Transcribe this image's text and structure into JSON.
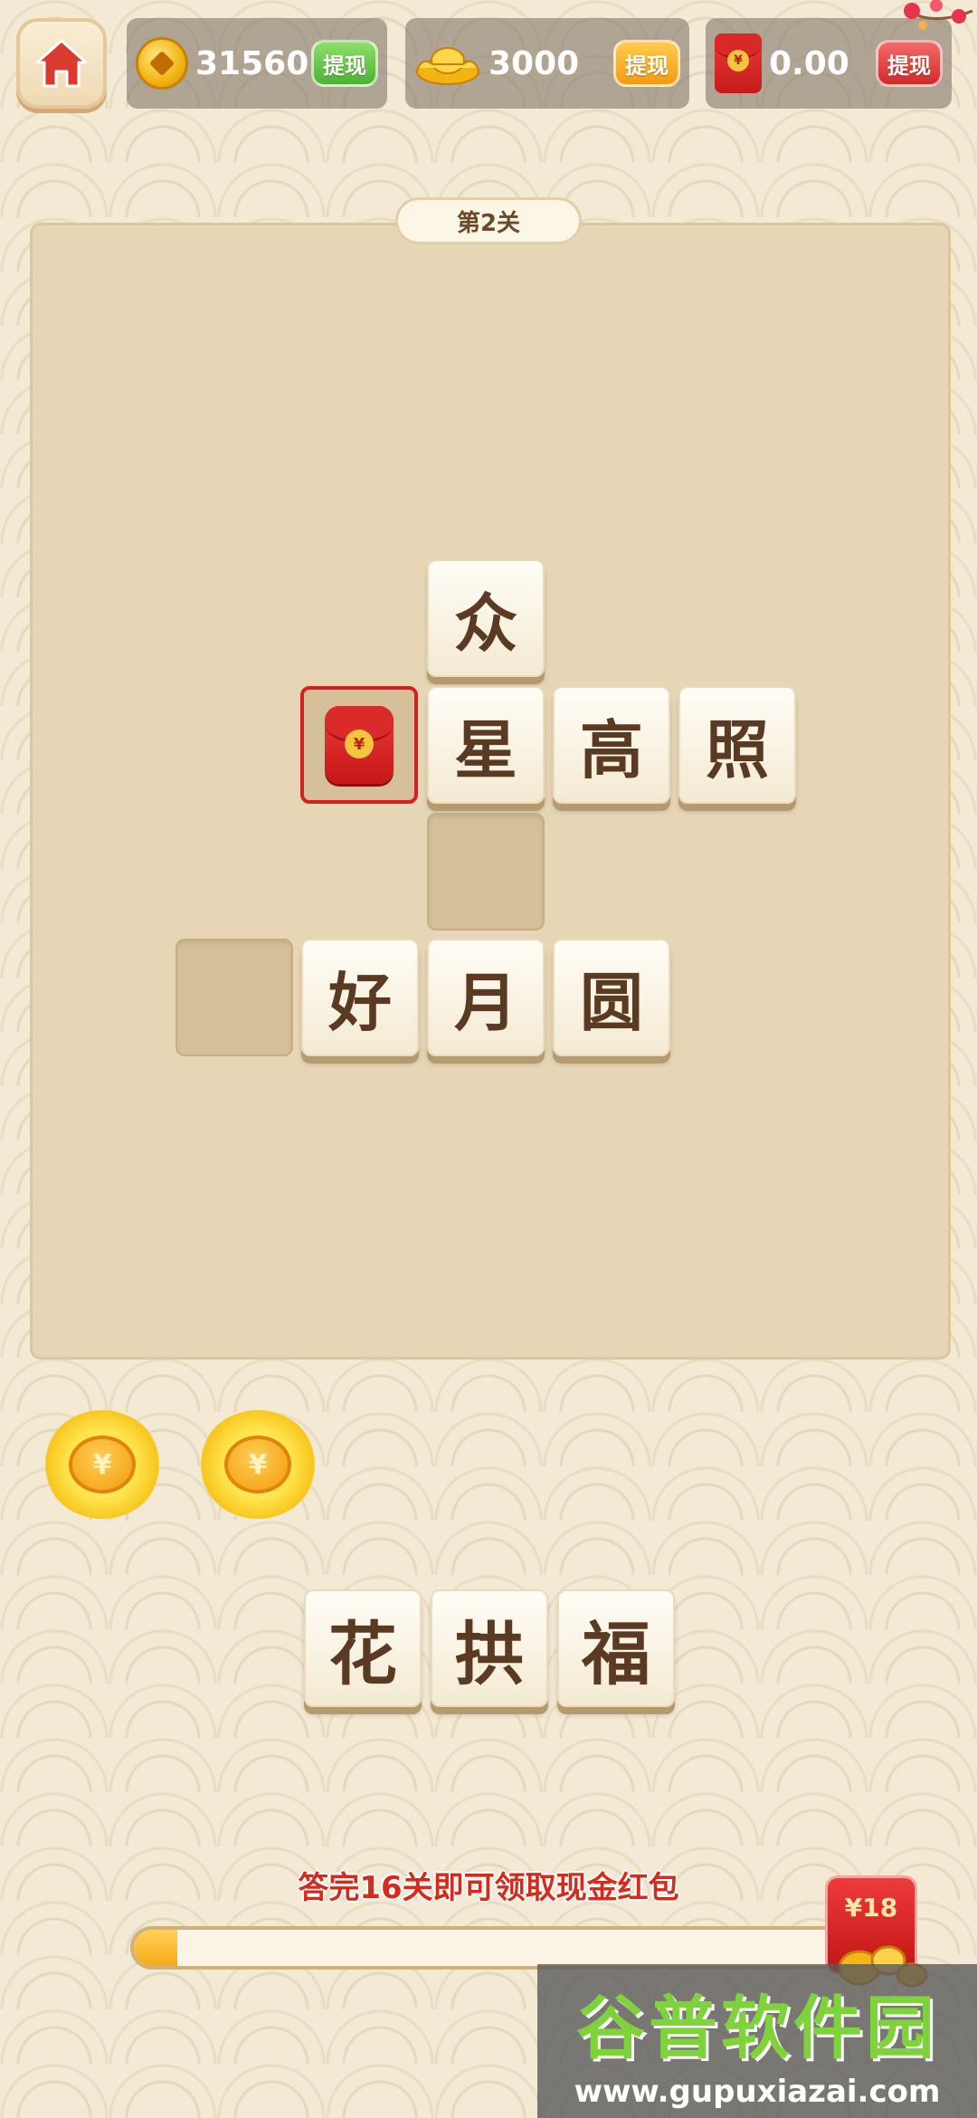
{
  "header": {
    "coins": {
      "value": "31560",
      "withdraw_label": "提现",
      "icon": "coin-icon"
    },
    "ingots": {
      "value": "3000",
      "withdraw_label": "提现",
      "icon": "gold-ingot-icon"
    },
    "cash": {
      "value": "0.00",
      "withdraw_label": "提现",
      "icon": "red-envelope-icon",
      "seal": "¥"
    }
  },
  "level": {
    "label": "第2关"
  },
  "board": {
    "row1": {
      "c1": "众"
    },
    "row2": {
      "c1": "星",
      "c2": "高",
      "c3": "照"
    },
    "row4": {
      "c1": "好",
      "c2": "月",
      "c3": "圆"
    },
    "selected_seal": "¥"
  },
  "hints": {
    "coin_symbol": "¥"
  },
  "candidates": [
    "花",
    "拱",
    "福"
  ],
  "progress": {
    "text": "答完16关即可领取现金红包",
    "fraction": 0.06,
    "reward": "¥18"
  },
  "watermark": {
    "brand": "谷普软件园",
    "url": "www.gupuxiazai.com"
  },
  "colors": {
    "accent_red": "#d42020",
    "tile_text": "#5a3a22",
    "board_bg": "#e7d6b6"
  }
}
